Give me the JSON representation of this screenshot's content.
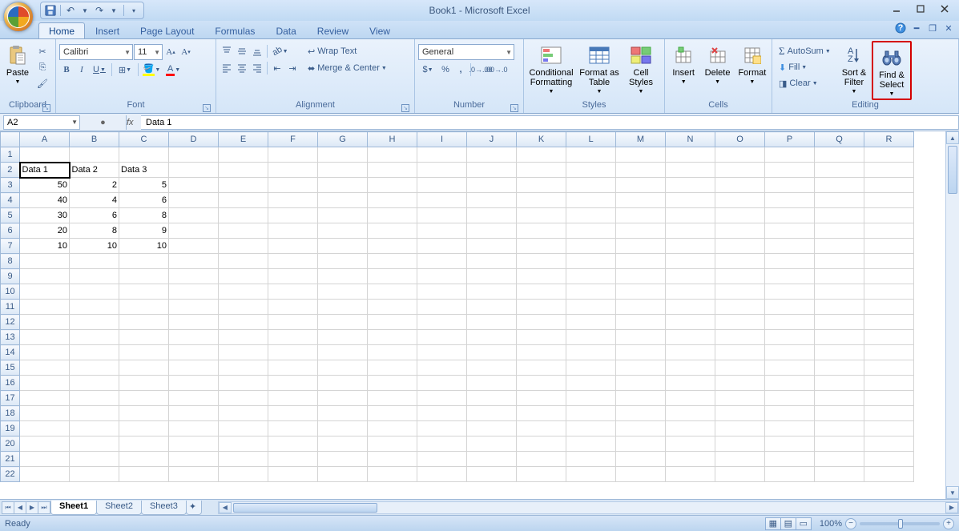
{
  "title": "Book1 - Microsoft Excel",
  "qat": {
    "save": "save-icon",
    "undo": "undo-icon",
    "redo": "redo-icon"
  },
  "tabs": [
    "Home",
    "Insert",
    "Page Layout",
    "Formulas",
    "Data",
    "Review",
    "View"
  ],
  "active_tab": "Home",
  "ribbon": {
    "clipboard": {
      "label": "Clipboard",
      "paste": "Paste"
    },
    "font": {
      "label": "Font",
      "name": "Calibri",
      "size": "11",
      "bold": "B",
      "italic": "I",
      "underline": "U"
    },
    "alignment": {
      "label": "Alignment",
      "wrap": "Wrap Text",
      "merge": "Merge & Center"
    },
    "number": {
      "label": "Number",
      "format": "General"
    },
    "styles": {
      "label": "Styles",
      "conditional": "Conditional Formatting",
      "astable": "Format as Table",
      "cell": "Cell Styles"
    },
    "cells": {
      "label": "Cells",
      "insert": "Insert",
      "delete": "Delete",
      "format": "Format"
    },
    "editing": {
      "label": "Editing",
      "autosum": "AutoSum",
      "fill": "Fill",
      "clear": "Clear",
      "sort": "Sort & Filter",
      "find": "Find & Select"
    }
  },
  "namebox": "A2",
  "formula": "Data 1",
  "columns": [
    "A",
    "B",
    "C",
    "D",
    "E",
    "F",
    "G",
    "H",
    "I",
    "J",
    "K",
    "L",
    "M",
    "N",
    "O",
    "P",
    "Q",
    "R"
  ],
  "rows": [
    1,
    2,
    3,
    4,
    5,
    6,
    7,
    8,
    9,
    10,
    11,
    12,
    13,
    14,
    15,
    16,
    17,
    18,
    19,
    20,
    21,
    22
  ],
  "selected_cell": "A2",
  "cells": {
    "A2": {
      "v": "Data 1",
      "t": true
    },
    "B2": {
      "v": "Data 2",
      "t": true
    },
    "C2": {
      "v": "Data 3",
      "t": true
    },
    "A3": {
      "v": "50"
    },
    "B3": {
      "v": "2"
    },
    "C3": {
      "v": "5"
    },
    "A4": {
      "v": "40"
    },
    "B4": {
      "v": "4"
    },
    "C4": {
      "v": "6"
    },
    "A5": {
      "v": "30"
    },
    "B5": {
      "v": "6"
    },
    "C5": {
      "v": "8"
    },
    "A6": {
      "v": "20"
    },
    "B6": {
      "v": "8"
    },
    "C6": {
      "v": "9"
    },
    "A7": {
      "v": "10"
    },
    "B7": {
      "v": "10"
    },
    "C7": {
      "v": "10"
    }
  },
  "sheets": [
    "Sheet1",
    "Sheet2",
    "Sheet3"
  ],
  "active_sheet": "Sheet1",
  "status": "Ready",
  "zoom": "100%"
}
